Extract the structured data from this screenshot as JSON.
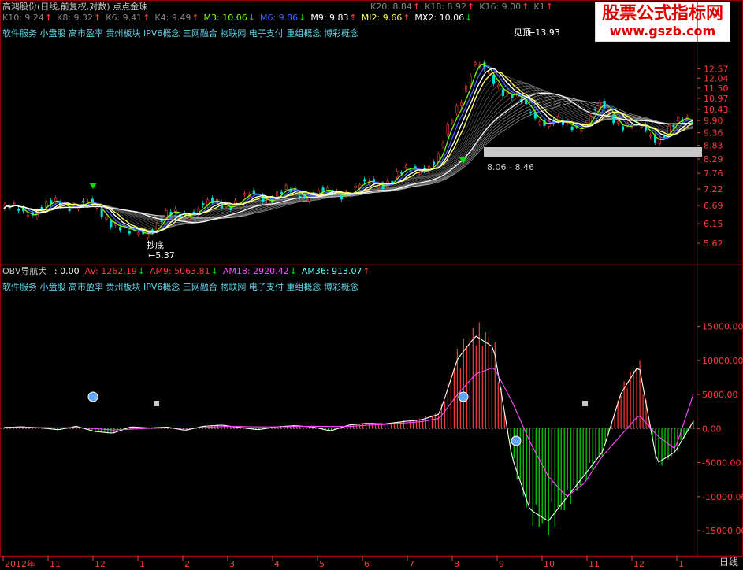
{
  "header": {
    "title": "高鸿股份(日线,前复权,对数) 点点金珠",
    "ma_row1": [
      {
        "label": "K10: 9.24",
        "dir": "up"
      },
      {
        "label": "K8: 9.32",
        "dir": "up"
      },
      {
        "label": "K6: 9.41",
        "dir": "up"
      },
      {
        "label": "K4: 9.49",
        "dir": "up"
      },
      {
        "label": "M3: 10.06",
        "dir": "dn",
        "color": "#7fff00"
      },
      {
        "label": "M6: 9.86",
        "dir": "dn",
        "color": "#4169ff"
      },
      {
        "label": "M9: 9.83",
        "dir": "up",
        "color": "#ffffff"
      },
      {
        "label": "MI2: 9.66",
        "dir": "up",
        "color": "#ffff66"
      },
      {
        "label": "MX2: 10.06",
        "dir": "dn",
        "color": "#ffffff"
      }
    ],
    "ma_row2": [
      {
        "label": "K20: 8.84",
        "dir": "up"
      },
      {
        "label": "K18: 8.92",
        "dir": "up"
      },
      {
        "label": "K16: 9.00",
        "dir": "up"
      },
      {
        "label": "K1",
        "dir": "up"
      }
    ],
    "concepts": "软件服务 小盘股 高市盈率 贵州板块 IPV6概念 三网融合 物联网 电子支付 重组概念 博彩概念"
  },
  "indicator_header": {
    "name": "OBV导航犬",
    "values": [
      {
        "label": ": 0.00",
        "dir": "",
        "color": "#ffffff"
      },
      {
        "label": "AV: 1262.19",
        "dir": "dn",
        "color": "#ff3b3b"
      },
      {
        "label": "AM9: 5063.81",
        "dir": "dn",
        "color": "#ff3b3b"
      },
      {
        "label": "AM18: 2920.42",
        "dir": "dn",
        "color": "#ff4dff"
      },
      {
        "label": "AM36: 913.07",
        "dir": "up",
        "color": "#66ffff"
      }
    ],
    "concepts": "软件服务 小盘股 高市盈率 贵州板块 IPV6概念 三网融合 物联网 电子支付 重组概念 博彩概念"
  },
  "watermark": {
    "title": "股票公式指标网",
    "url": "www.gszb.com"
  },
  "period_label": "日线",
  "colors": {
    "up": "#ff3b3b",
    "down": "#00e0e0",
    "grid": "#5a0000",
    "axis_text": "#ff3b3b"
  },
  "chart_data": [
    {
      "type": "line",
      "title": "高鸿股份(日线,前复权,对数)",
      "y_scale": "log",
      "ylim": [
        5.4,
        14.4
      ],
      "yticks": [
        5.62,
        6.15,
        6.69,
        7.22,
        7.76,
        8.29,
        8.83,
        9.36,
        9.9,
        10.43,
        10.97,
        11.5,
        12.04,
        12.57
      ],
      "x_labels": [
        "2012年",
        "11",
        "12",
        "1",
        "2",
        "3",
        "4",
        "5",
        "6",
        "7",
        "8",
        "9",
        "10",
        "11",
        "12",
        "1"
      ],
      "series": [
        {
          "name": "M3",
          "values": [
            6.6,
            6.5,
            6.6,
            6.7,
            6.8,
            6.6,
            6.3,
            5.8,
            6.0,
            6.3,
            6.5,
            6.6,
            6.8,
            6.8,
            7.0,
            7.0,
            7.1,
            7.1,
            7.0,
            7.2,
            7.3,
            7.5,
            7.7,
            8.0,
            8.2,
            10.5,
            12.8,
            12.0,
            11.2,
            10.3,
            9.9,
            9.6,
            9.8,
            10.5,
            9.9,
            9.5,
            9.2,
            9.6,
            10.06
          ]
        }
      ],
      "annotations": [
        "抄底",
        "←5.37",
        "见顶",
        "←13.93",
        "8.06 - 8.46"
      ]
    },
    {
      "type": "bar",
      "title": "OBV导航犬",
      "ylim": [
        -18000,
        19000
      ],
      "yticks": [
        15000,
        10000,
        5000,
        0,
        -5000,
        -10000,
        -15000
      ],
      "x_labels": [
        "2012年",
        "11",
        "12",
        "1",
        "2",
        "3",
        "4",
        "5",
        "6",
        "7",
        "8",
        "9",
        "10",
        "11",
        "12",
        "1"
      ],
      "series": [
        {
          "name": "AV",
          "values": [
            200,
            300,
            150,
            -200,
            400,
            -500,
            -800,
            300,
            100,
            250,
            -300,
            400,
            600,
            200,
            -200,
            300,
            500,
            300,
            -400,
            600,
            900,
            800,
            1200,
            1500,
            2500,
            12000,
            16000,
            14000,
            -5000,
            -14000,
            -16000,
            -12000,
            -8000,
            -4000,
            6000,
            11000,
            -6000,
            -4000,
            1262.19
          ]
        },
        {
          "name": "AM9",
          "values": [
            100,
            150,
            150,
            100,
            150,
            0,
            -200,
            -100,
            50,
            100,
            50,
            150,
            300,
            300,
            250,
            250,
            300,
            350,
            300,
            300,
            500,
            600,
            800,
            1000,
            1500,
            5000,
            8000,
            9000,
            4000,
            -2000,
            -7000,
            -10000,
            -8000,
            -4000,
            -1000,
            2000,
            -1000,
            -3000,
            5063.81
          ]
        }
      ]
    }
  ]
}
